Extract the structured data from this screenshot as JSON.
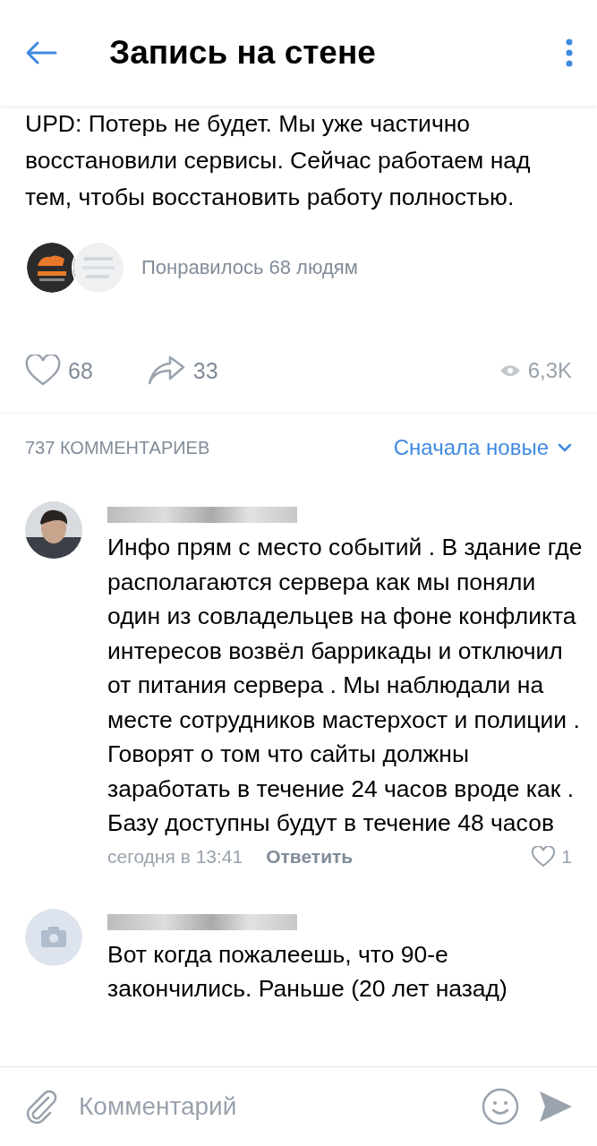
{
  "header": {
    "title": "Запись на стене"
  },
  "post": {
    "text": "UPD: Потерь не будет. Мы уже частично восстановили сервисы. Сейчас работаем над тем, чтобы восстановить работу полностью.",
    "liked_by": "Понравилось 68 людям",
    "likes": "68",
    "reposts": "33",
    "views": "6,3K"
  },
  "comments_header": {
    "count": "737 КОММЕНТАРИЕВ",
    "sort": "Сначала новые"
  },
  "comments": [
    {
      "text": "Инфо прям с место событий . В  здание где располагаются сервера как мы поняли один из совладельцев на фоне конфликта интересов возвёл баррикады и отключил от питания сервера . Мы наблюдали на месте сотрудников мастерхост и полиции . Говорят о  том что сайты должны заработать в течение 24 часов вроде как . Базу доступны будут в течение 48 часов",
      "time": "сегодня в 13:41",
      "reply": "Ответить",
      "likes": "1"
    },
    {
      "kind": "camera",
      "text": "Вот когда пожалеешь, что 90-е закончились. Раньше (20 лет назад)"
    }
  ],
  "composer": {
    "placeholder": "Комментарий"
  }
}
